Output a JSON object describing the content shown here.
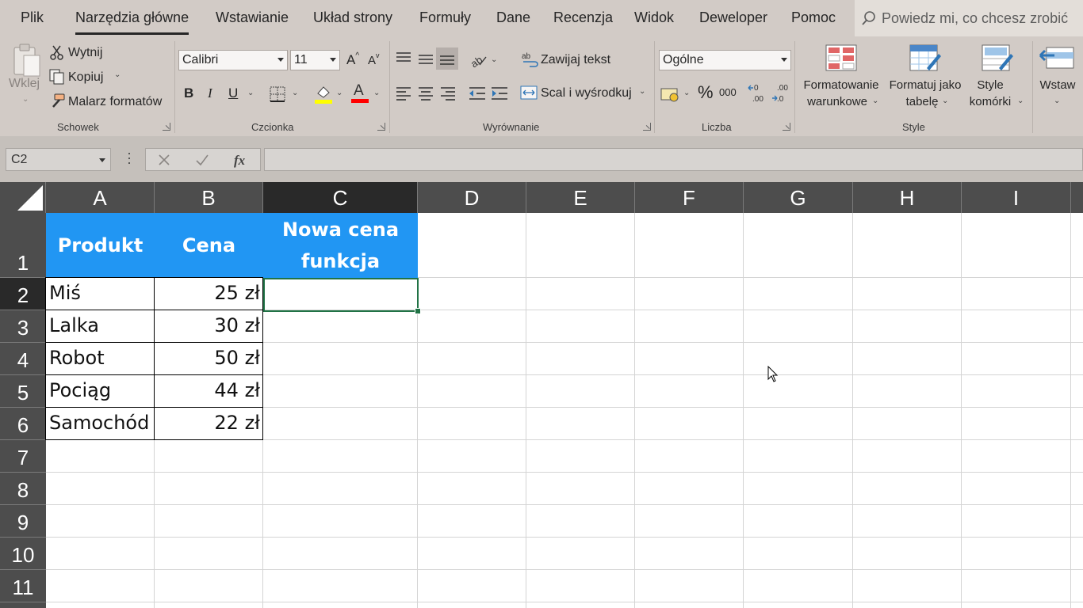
{
  "tabs": {
    "file": "Plik",
    "home": "Narzędzia główne",
    "insert": "Wstawianie",
    "layout": "Układ strony",
    "formulas": "Formuły",
    "data": "Dane",
    "review": "Recenzja",
    "view": "Widok",
    "developer": "Deweloper",
    "help": "Pomoc",
    "tell_me_placeholder": "Powiedz mi, co chcesz zrobić"
  },
  "ribbon": {
    "clipboard": {
      "paste": "Wklej",
      "cut": "Wytnij",
      "copy": "Kopiuj",
      "format_painter": "Malarz formatów",
      "group": "Schowek"
    },
    "font": {
      "name": "Calibri",
      "size": "11",
      "bold": "B",
      "italic": "I",
      "underline": "U",
      "grow": "A",
      "shrink": "A",
      "color_letter": "A",
      "group": "Czcionka",
      "fill_color": "#ffff00",
      "font_color": "#ff0000"
    },
    "alignment": {
      "wrap": "Zawijaj tekst",
      "merge": "Scal i wyśrodkuj",
      "group": "Wyrównanie"
    },
    "number": {
      "format": "Ogólne",
      "percent": "%",
      "thousands": "000",
      "group": "Liczba"
    },
    "styles": {
      "conditional_line1": "Formatowanie",
      "conditional_line2": "warunkowe",
      "table_line1": "Formatuj jako",
      "table_line2": "tabelę",
      "cell_line1": "Style",
      "cell_line2": "komórki",
      "group": "Style"
    },
    "cells": {
      "insert": "Wstaw"
    }
  },
  "formula_bar": {
    "name_box": "C2",
    "content": ""
  },
  "grid": {
    "columns": [
      "A",
      "B",
      "C",
      "D",
      "E",
      "F",
      "G",
      "H",
      "I"
    ],
    "rows": [
      "1",
      "2",
      "3",
      "4",
      "5",
      "6",
      "7",
      "8",
      "9",
      "10",
      "11"
    ],
    "selected_col": "C",
    "selected_row": "2",
    "header": {
      "product": "Produkt",
      "price": "Cena",
      "new_price_line1": "Nowa cena",
      "new_price_line2": "funkcja"
    },
    "data": [
      {
        "product": "Miś",
        "price": "25 zł"
      },
      {
        "product": "Lalka",
        "price": "30 zł"
      },
      {
        "product": "Robot",
        "price": "50 zł"
      },
      {
        "product": "Pociąg",
        "price": "44 zł"
      },
      {
        "product": "Samochód",
        "price": "22 zł"
      }
    ],
    "header_color": "#2196f3",
    "selection_color": "#217346"
  }
}
